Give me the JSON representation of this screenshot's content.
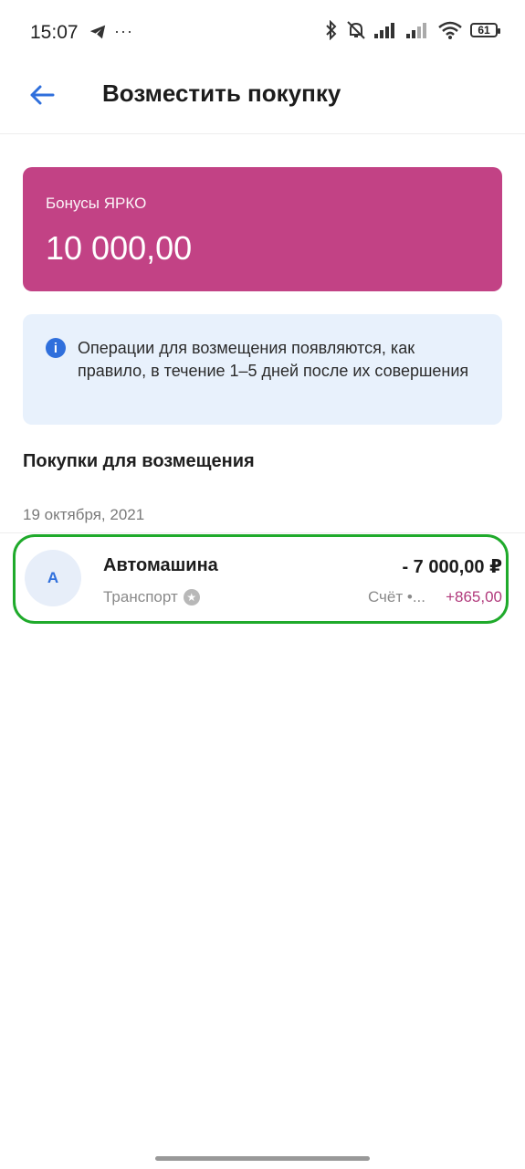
{
  "status_bar": {
    "time": "15:07",
    "more": "···",
    "battery": "61",
    "icons": [
      "telegram-icon",
      "bluetooth-icon",
      "mute-bell-icon",
      "signal-icon",
      "signal-icon",
      "wifi-icon",
      "battery-icon"
    ]
  },
  "header": {
    "title": "Возместить покупку",
    "back_icon": "arrow-left-icon"
  },
  "bonus_card": {
    "label": "Бонусы ЯРКО",
    "amount": "10 000,00",
    "color": "#c24285"
  },
  "info": {
    "icon": "info-icon",
    "icon_glyph": "i",
    "text": "Операции для возмещения появляются, как правило, в течение 1–5 дней после их совершения"
  },
  "purchases": {
    "section_title": "Покупки для возмещения",
    "groups": [
      {
        "date": "19 октября, 2021",
        "items": [
          {
            "avatar_letter": "А",
            "name": "Автомашина",
            "category": "Транспорт",
            "amount": "- 7 000,00 ₽",
            "account": "Счёт •...",
            "bonus": "+865,00",
            "highlight_color": "#1faa2b"
          }
        ]
      }
    ]
  }
}
